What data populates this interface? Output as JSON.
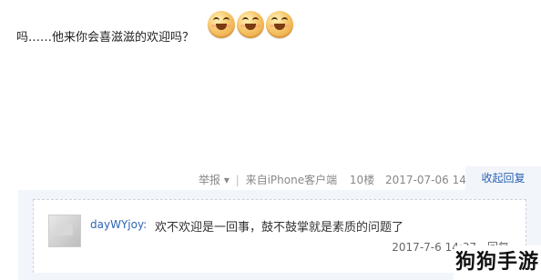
{
  "post": {
    "text": "吗……他来你会喜滋滋的欢迎吗？",
    "emoji_icons": [
      "smiley-emoji-icon",
      "smiley-emoji-icon",
      "smiley-emoji-icon"
    ]
  },
  "meta": {
    "report_label": "举报",
    "dropdown_glyph": "▾",
    "separator": "|",
    "client_label": "来自iPhone客户端",
    "floor": "10楼",
    "timestamp": "2017-07-06 14:28",
    "collapse_reply_label": "收起回复"
  },
  "reply": {
    "username": "dayWYjoy:",
    "text": "欢不欢迎是一回事，鼓不鼓掌就是素质的问题了",
    "timestamp": "2017-7-6 14:37",
    "reply_label": "回复"
  },
  "watermark": {
    "text": "狗狗手游"
  },
  "colors": {
    "link": "#2d64b3",
    "reply_bg": "#f2f5f9",
    "meta_text": "#888888"
  }
}
